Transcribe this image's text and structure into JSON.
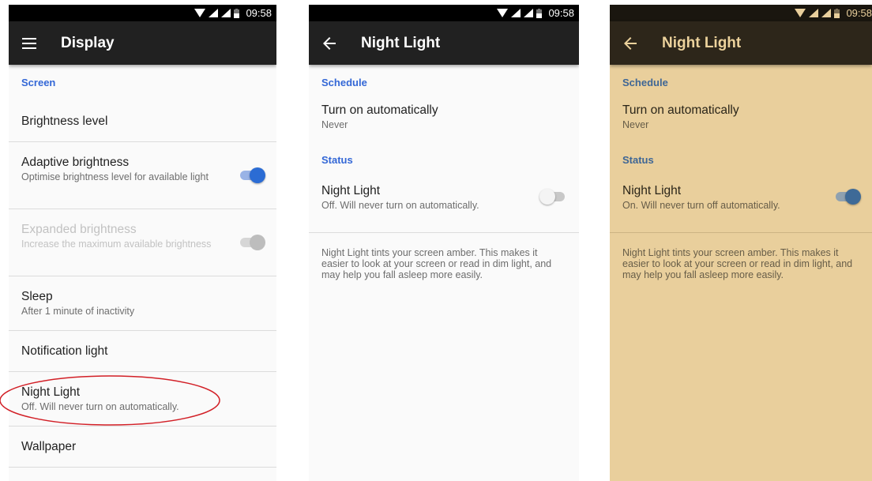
{
  "status_bar": {
    "time": "09:58"
  },
  "display_screen": {
    "title": "Display",
    "nav_icon": "menu-icon",
    "section": "Screen",
    "items": [
      {
        "title": "Brightness level"
      },
      {
        "title": "Adaptive brightness",
        "subtitle": "Optimise brightness level for available light",
        "toggle": "on"
      },
      {
        "title": "Expanded brightness",
        "subtitle": "Increase the maximum available brightness",
        "toggle": "disabled"
      },
      {
        "title": "Sleep",
        "subtitle": "After 1 minute of inactivity"
      },
      {
        "title": "Notification light"
      },
      {
        "title": "Night Light",
        "subtitle": "Off. Will never turn on automatically."
      },
      {
        "title": "Wallpaper"
      }
    ]
  },
  "night_light_off": {
    "title": "Night Light",
    "nav_icon": "back-arrow-icon",
    "schedule_label": "Schedule",
    "auto_title": "Turn on automatically",
    "auto_value": "Never",
    "status_label": "Status",
    "toggle_title": "Night Light",
    "toggle_subtitle": "Off. Will never turn on automatically.",
    "toggle_state": "off",
    "description": "Night Light tints your screen amber. This makes it easier to look at your screen or read in dim light, and may help you fall asleep more easily."
  },
  "night_light_on": {
    "title": "Night Light",
    "nav_icon": "back-arrow-icon",
    "schedule_label": "Schedule",
    "auto_title": "Turn on automatically",
    "auto_value": "Never",
    "status_label": "Status",
    "toggle_title": "Night Light",
    "toggle_subtitle": "On. Will never turn off automatically.",
    "toggle_state": "on",
    "description": "Night Light tints your screen amber. This makes it easier to look at your screen or read in dim light, and may help you fall asleep more easily."
  },
  "colors": {
    "accent": "#3367d6",
    "amber_background": "#e9cf9c",
    "annotation": "#d21f26"
  }
}
